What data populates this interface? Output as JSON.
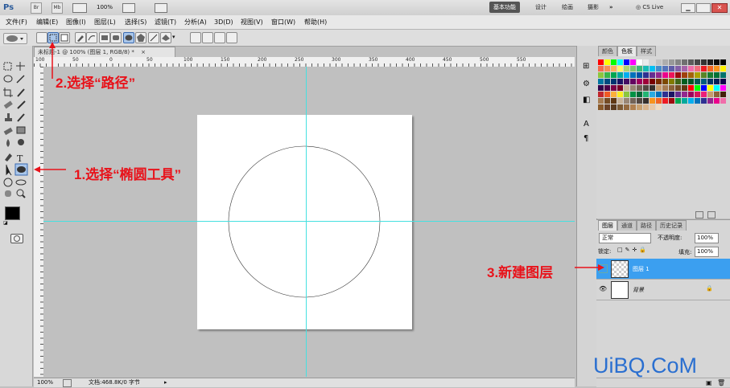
{
  "app": {
    "logo": "Ps",
    "title_buttons": [
      "Br",
      "Mb"
    ],
    "zoom_display": "100%",
    "workspaces": [
      "基本功能",
      "设计",
      "绘画",
      "摄影"
    ],
    "more_workspaces": "»",
    "cs_live": "CS Live"
  },
  "menu": [
    "文件(F)",
    "编辑(E)",
    "图像(I)",
    "图层(L)",
    "选择(S)",
    "滤镜(T)",
    "分析(A)",
    "3D(D)",
    "视图(V)",
    "窗口(W)",
    "帮助(H)"
  ],
  "document": {
    "tab_title": "未标题-1 @ 100% (图层 1, RGB/8) *",
    "ruler_numbers": [
      "100",
      "50",
      "0",
      "50",
      "100",
      "150",
      "200",
      "250",
      "300",
      "350",
      "400",
      "450",
      "500",
      "550"
    ],
    "status_zoom": "100%",
    "status_doc": "文档:468.8K/0 字节"
  },
  "panels": {
    "swatch_tabs": [
      "颜色",
      "色板",
      "样式"
    ],
    "layer_tabs": [
      "图层",
      "通道",
      "路径",
      "历史记录"
    ],
    "blend_mode": "正常",
    "opacity_label": "不透明度:",
    "opacity_value": "100%",
    "lock_label": "锁定:",
    "fill_label": "填充:",
    "fill_value": "100%",
    "layers": [
      {
        "name": "图层 1",
        "selected": true
      },
      {
        "name": "背景",
        "selected": false
      }
    ]
  },
  "annotations": {
    "step1": "1.选择“椭圆工具”",
    "step2": "2.选择“路径”",
    "step3": "3.新建图层"
  },
  "watermark": "UiBQ.CoM",
  "colors": {
    "guide": "#45e0e0",
    "annotation": "#e8131b",
    "selected_layer": "#3b9ff0",
    "watermark": "#2a6fd0"
  }
}
